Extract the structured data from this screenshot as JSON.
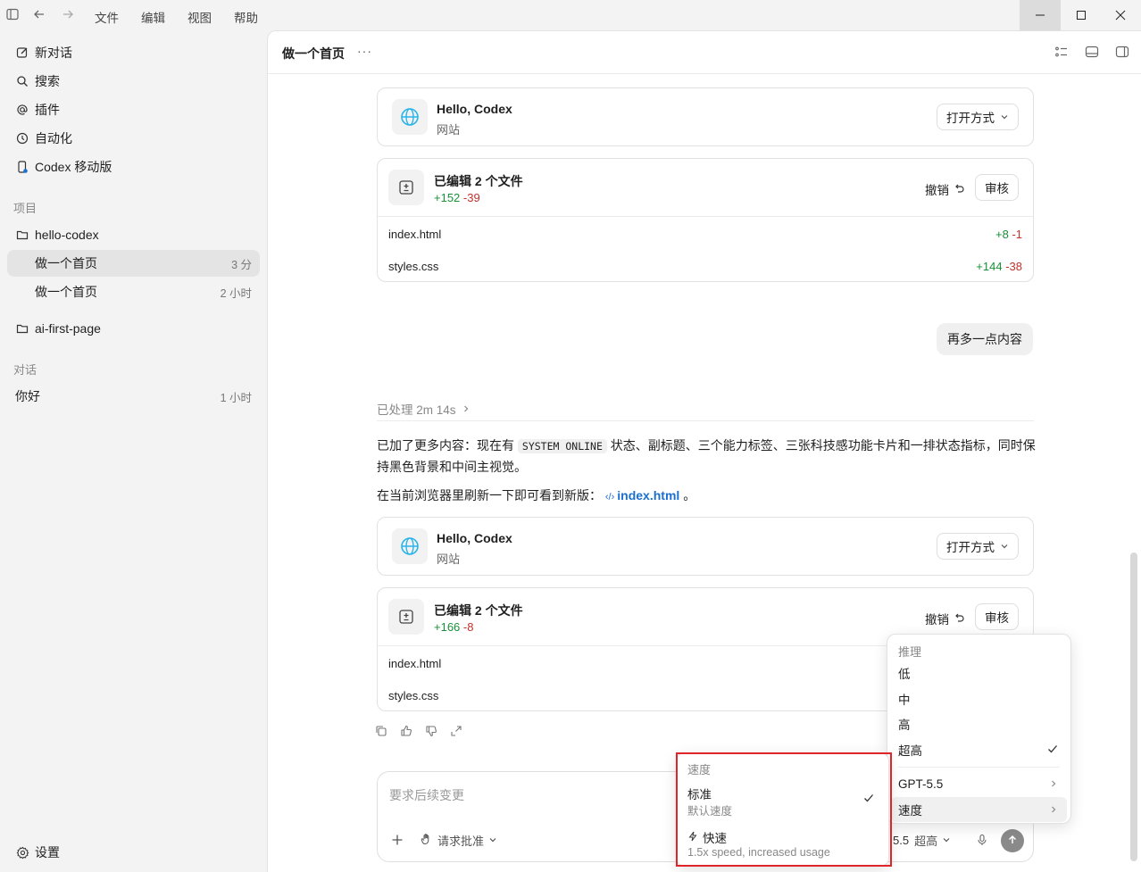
{
  "menu": [
    "文件",
    "编辑",
    "视图",
    "帮助"
  ],
  "sidebar": {
    "nav": [
      {
        "label": "新对话",
        "icon": "edit-icon"
      },
      {
        "label": "搜索",
        "icon": "search-icon"
      },
      {
        "label": "插件",
        "icon": "at-icon"
      },
      {
        "label": "自动化",
        "icon": "clock-icon"
      },
      {
        "label": "Codex 移动版",
        "icon": "mobile-icon"
      }
    ],
    "projects_label": "项目",
    "project1": "hello-codex",
    "threads": [
      {
        "label": "做一个首页",
        "meta": "3 分"
      },
      {
        "label": "做一个首页",
        "meta": "2 小时"
      }
    ],
    "project2": "ai-first-page",
    "chats_label": "对话",
    "chat1": {
      "label": "你好",
      "meta": "1 小时"
    },
    "settings": "设置"
  },
  "header": {
    "title": "做一个首页",
    "more": "···"
  },
  "site_card1": {
    "title": "Hello, Codex",
    "sub": "网站",
    "open": "打开方式"
  },
  "edit_card1": {
    "title": "已编辑 2 个文件",
    "added": "+152",
    "removed": "-39",
    "undo": "撤销",
    "review": "审核",
    "files": [
      {
        "name": "index.html",
        "added": "+8",
        "removed": "-1"
      },
      {
        "name": "styles.css",
        "added": "+144",
        "removed": "-38"
      }
    ]
  },
  "user_message": "再多一点内容",
  "processed": "已处理 2m 14s",
  "reply": {
    "p1_a": "已加了更多内容：现在有 ",
    "p1_code": "SYSTEM ONLINE",
    "p1_b": " 状态、副标题、三个能力标签、三张科技感功能卡片和一排状态指标，同时保持黑色背景和中间主视觉。",
    "p2_a": "在当前浏览器里刷新一下即可看到新版：",
    "p2_link": "index.html",
    "p2_b": "。"
  },
  "site_card2": {
    "title": "Hello, Codex",
    "sub": "网站",
    "open": "打开方式"
  },
  "edit_card2": {
    "title": "已编辑 2 个文件",
    "added": "+166",
    "removed": "-8",
    "undo": "撤销",
    "review": "审核",
    "files": [
      {
        "name": "index.html"
      },
      {
        "name": "styles.css"
      }
    ]
  },
  "composer": {
    "placeholder": "要求后续变更",
    "approval": "请求批准",
    "model_short": "5.5",
    "effort": "超高"
  },
  "reasoning_menu": {
    "header": "推理",
    "options": [
      "低",
      "中",
      "高",
      "超高"
    ],
    "selected": "超高",
    "model": "GPT-5.5",
    "speed": "速度"
  },
  "speed_menu": {
    "header": "速度",
    "standard": {
      "title": "标准",
      "sub": "默认速度"
    },
    "fast": {
      "title": "快速",
      "sub": "1.5x speed, increased usage"
    }
  },
  "colors": {
    "added": "#1a8f3a",
    "removed": "#c4302b",
    "link": "#1a6fd1",
    "highlight_box": "#e0242a"
  }
}
